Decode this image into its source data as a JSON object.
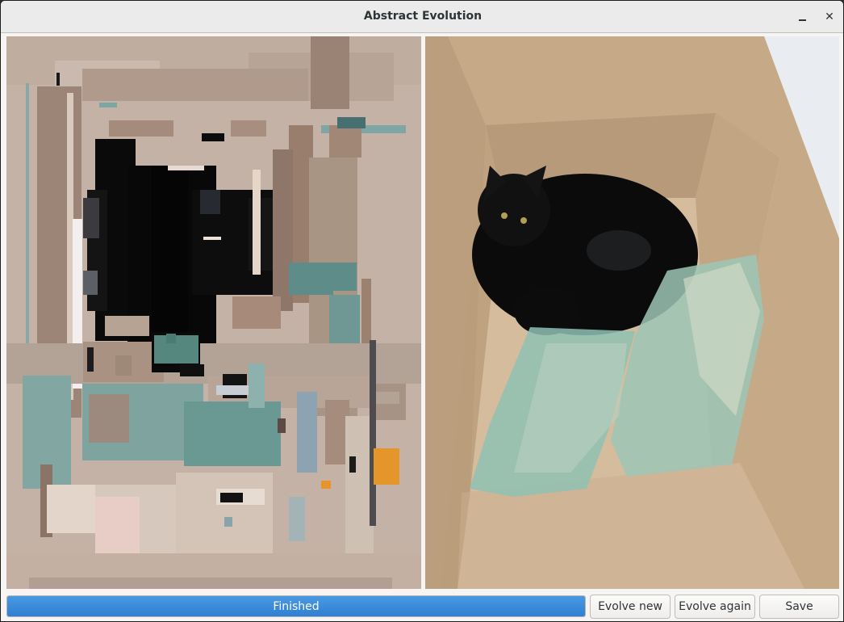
{
  "window": {
    "title": "Abstract Evolution",
    "controls": {
      "minimize": "minimize-icon",
      "close_label": "✕"
    }
  },
  "panels": {
    "left": {
      "content": "evolved-abstract-rectangles"
    },
    "right": {
      "content": "photo-black-cat-in-cardboard-box"
    }
  },
  "status": {
    "progress_label": "Finished",
    "progress_fraction": 1.0,
    "accent_color": "#3584e4"
  },
  "buttons": {
    "evolve_new": "Evolve new",
    "evolve_again": "Evolve again",
    "save": "Save"
  }
}
